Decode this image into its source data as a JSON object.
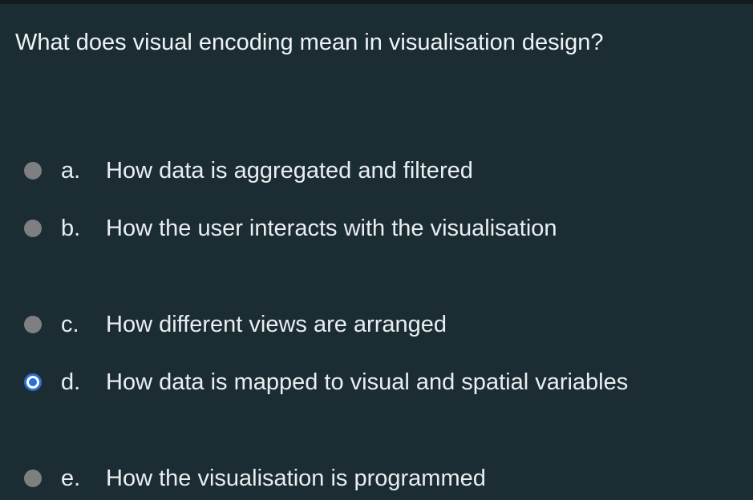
{
  "question": {
    "text": "What does visual encoding mean in visualisation design?"
  },
  "options": [
    {
      "letter": "a.",
      "text": "How data is aggregated and filtered",
      "selected": false
    },
    {
      "letter": "b.",
      "text": "How the user interacts with the visualisation",
      "selected": false
    },
    {
      "letter": "c.",
      "text": "How different views are arranged",
      "selected": false
    },
    {
      "letter": "d.",
      "text": "How data is mapped to visual and spatial variables",
      "selected": true
    },
    {
      "letter": "e.",
      "text": "How the visualisation is programmed",
      "selected": false
    }
  ],
  "colors": {
    "background": "#1b2d33",
    "text": "#e9eef0",
    "radio_unchecked": "#7d7f80",
    "radio_checked_accent": "#2a6fd6"
  }
}
